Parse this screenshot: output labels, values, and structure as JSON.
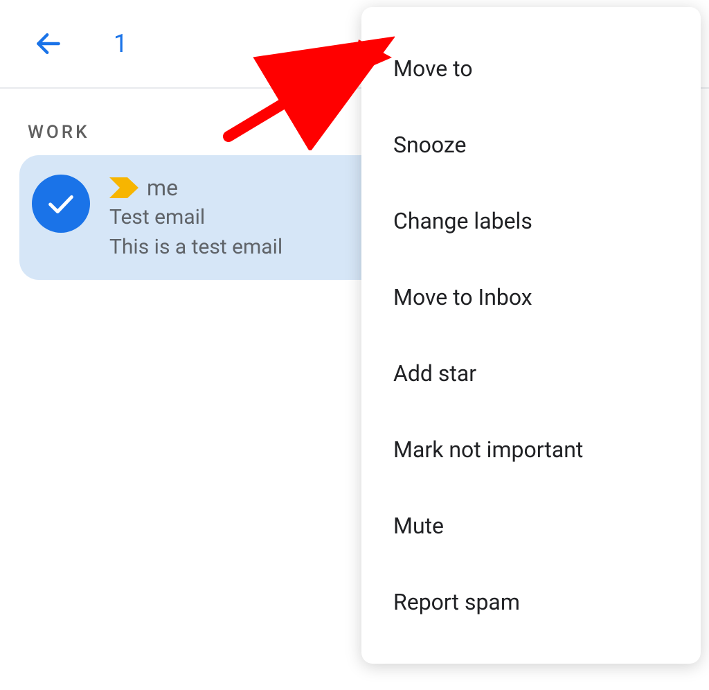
{
  "toolbar": {
    "selected_count": "1"
  },
  "label": {
    "name": "WORK"
  },
  "email": {
    "sender": "me",
    "subject": "Test email",
    "preview": "This is a test email"
  },
  "menu": {
    "items": [
      "Move to",
      "Snooze",
      "Change labels",
      "Move to Inbox",
      "Add star",
      "Mark not important",
      "Mute",
      "Report spam"
    ]
  }
}
